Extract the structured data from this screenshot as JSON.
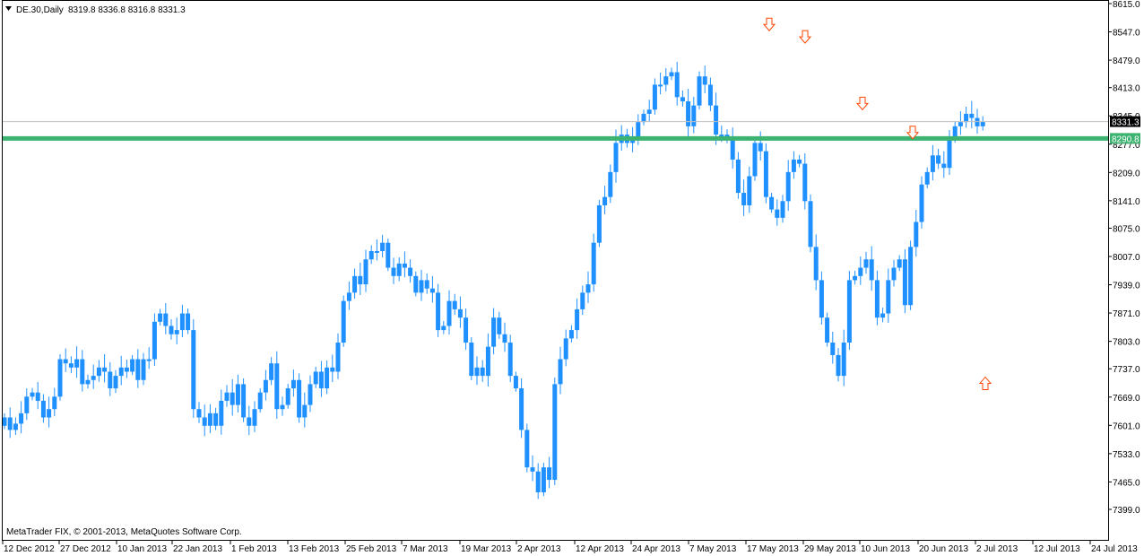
{
  "header": {
    "symbol": "DE.30,Daily",
    "ohlc": "8319.8 8336.8 8316.8 8331.3"
  },
  "footer": {
    "copyright": "MetaTrader FIX, © 2001-2013, MetaQuotes Software Corp."
  },
  "colors": {
    "candle": "#1e90ff",
    "support_line": "#3cb371",
    "current_price_line": "#c0c0c0",
    "arrow": "#ff4500",
    "axis": "#000000",
    "price_tag_bg": "#000000",
    "support_tag_bg": "#3cb371"
  },
  "chart_data": {
    "type": "candlestick",
    "ylim": [
      7399,
      8615
    ],
    "y_ticks": [
      "8615.0",
      "8547.0",
      "8479.0",
      "8413.0",
      "8345.0",
      "8277.0",
      "8209.0",
      "8141.0",
      "8075.0",
      "8007.0",
      "7939.0",
      "7871.0",
      "7803.0",
      "7737.0",
      "7669.0",
      "7601.0",
      "7533.0",
      "7465.0",
      "7399.0"
    ],
    "x_ticks": [
      "12 Dec 2012",
      "27 Dec 2012",
      "10 Jan 2013",
      "22 Jan 2013",
      "1 Feb 2013",
      "13 Feb 2013",
      "25 Feb 2013",
      "7 Mar 2013",
      "19 Mar 2013",
      "2 Apr 2013",
      "12 Apr 2013",
      "24 Apr 2013",
      "7 May 2013",
      "17 May 2013",
      "29 May 2013",
      "10 Jun 2013",
      "20 Jun 2013",
      "2 Jul 2013",
      "12 Jul 2013",
      "24 Jul 2013"
    ],
    "current_price": "8331.3",
    "current_price_value": 8331.3,
    "support_level": "8290.8",
    "support_level_value": 8290.8,
    "close": [
      7620,
      7590,
      7605,
      7630,
      7670,
      7680,
      7660,
      7620,
      7640,
      7670,
      7760,
      7750,
      7740,
      7760,
      7700,
      7710,
      7720,
      7740,
      7730,
      7690,
      7720,
      7740,
      7730,
      7760,
      7710,
      7760,
      7760,
      7850,
      7870,
      7840,
      7820,
      7830,
      7870,
      7830,
      7640,
      7620,
      7600,
      7630,
      7600,
      7660,
      7680,
      7650,
      7700,
      7620,
      7600,
      7640,
      7680,
      7710,
      7750,
      7640,
      7650,
      7690,
      7710,
      7620,
      7650,
      7700,
      7730,
      7690,
      7740,
      7730,
      7800,
      7900,
      7920,
      7960,
      7940,
      8000,
      8020,
      8020,
      8040,
      7980,
      7960,
      7990,
      7980,
      7960,
      7920,
      7950,
      7930,
      7920,
      7830,
      7840,
      7900,
      7880,
      7860,
      7800,
      7720,
      7740,
      7720,
      7790,
      7860,
      7820,
      7800,
      7720,
      7690,
      7590,
      7500,
      7490,
      7440,
      7500,
      7470,
      7700,
      7760,
      7810,
      7830,
      7880,
      7920,
      7940,
      8040,
      8130,
      8150,
      8210,
      8280,
      8300,
      8280,
      8290,
      8330,
      8350,
      8360,
      8420,
      8420,
      8440,
      8450,
      8390,
      8380,
      8320,
      8370,
      8440,
      8420,
      8370,
      8300,
      8300,
      8290,
      8240,
      8160,
      8130,
      8200,
      8280,
      8260,
      8150,
      8120,
      8100,
      8140,
      8210,
      8240,
      8230,
      8140,
      8030,
      7950,
      7860,
      7800,
      7770,
      7720,
      7800,
      7950,
      7960,
      7980,
      8000,
      7950,
      7860,
      7870,
      7950,
      7980,
      8000,
      7890,
      8030,
      8090,
      8180,
      8210,
      8250,
      8230,
      8220,
      8290,
      8320,
      8330,
      8350,
      8340,
      8320,
      8331.3
    ],
    "arrows": [
      {
        "direction": "down",
        "price": 8565
      },
      {
        "direction": "down",
        "price": 8535
      },
      {
        "direction": "down",
        "price": 8375
      },
      {
        "direction": "down",
        "price": 8305
      },
      {
        "direction": "up",
        "price": 7702
      }
    ]
  }
}
